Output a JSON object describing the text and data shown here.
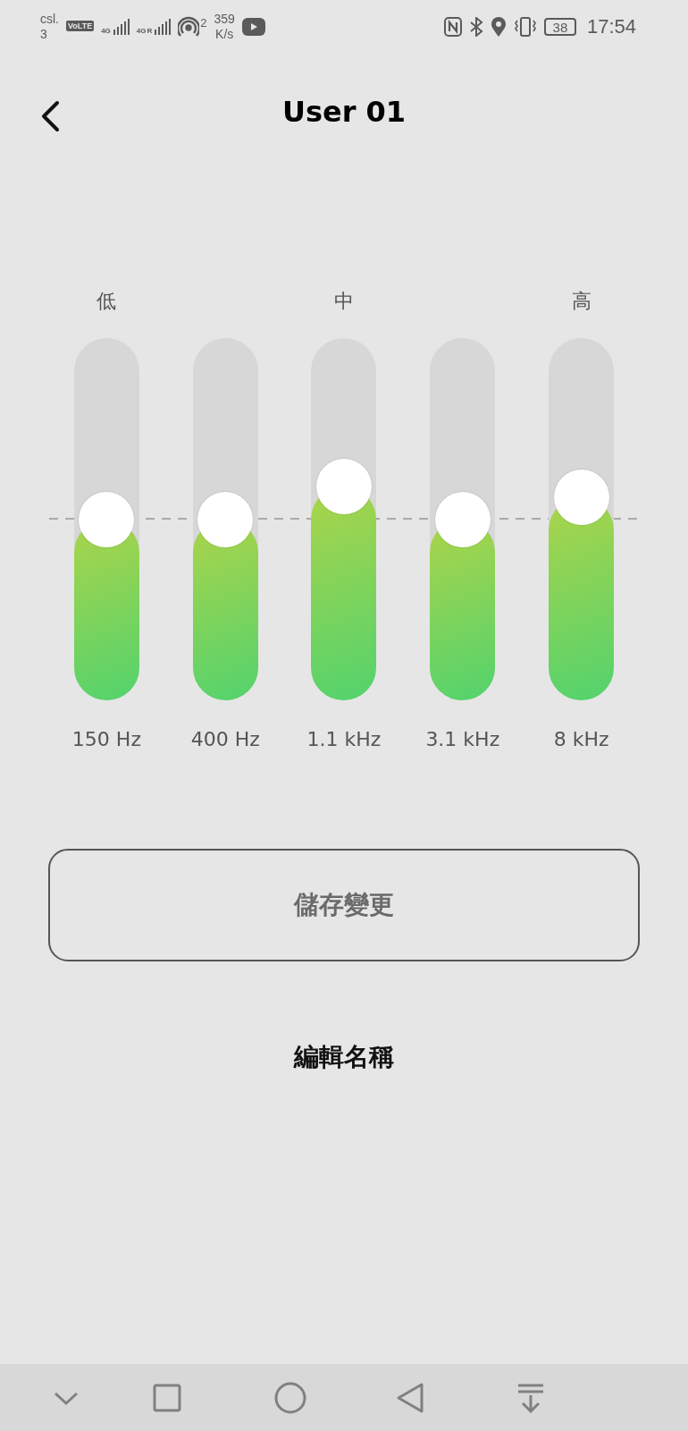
{
  "status_bar": {
    "carrier": "csl.",
    "carrier_line2": "3",
    "volte": "VoLTE",
    "sim1_network": "4G",
    "sim2_network": "4G",
    "sim2_roaming": "R",
    "hotspot_count": "2",
    "speed": "359",
    "speed_unit": "K/s",
    "battery": "38",
    "time": "17:54"
  },
  "header": {
    "title": "User 01"
  },
  "equalizer": {
    "bands": [
      {
        "label": "低",
        "frequency": "150 Hz",
        "level": 0.5
      },
      {
        "frequency": "400 Hz",
        "level": 0.5
      },
      {
        "label": "中",
        "frequency": "1.1 kHz",
        "level": 0.59
      },
      {
        "frequency": "3.1 kHz",
        "level": 0.5
      },
      {
        "label": "高",
        "frequency": "8 kHz",
        "level": 0.56
      }
    ]
  },
  "save_button": {
    "label": "儲存變更"
  },
  "edit_name_button": {
    "label": "編輯名稱"
  }
}
